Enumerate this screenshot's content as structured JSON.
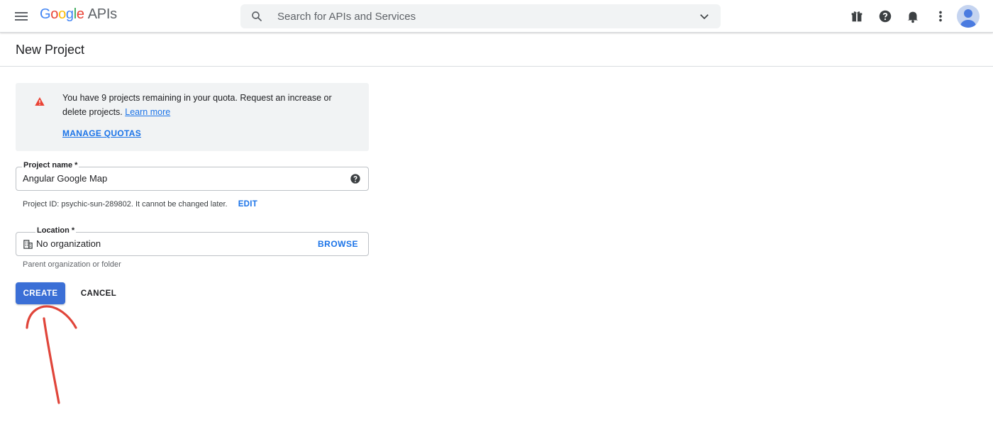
{
  "header": {
    "logo_letters": [
      "G",
      "o",
      "o",
      "g",
      "l",
      "e"
    ],
    "logo_suffix": "APIs",
    "search_placeholder": "Search for APIs and Services",
    "icons": [
      "menu-icon",
      "search-icon",
      "chevron-down-icon",
      "gift-icon",
      "help-icon",
      "notifications-bell-icon",
      "more-vert-icon",
      "avatar"
    ]
  },
  "page": {
    "title": "New Project"
  },
  "quota_notice": {
    "text": "You have 9 projects remaining in your quota. Request an increase or delete projects.",
    "learn_more": "Learn more",
    "manage_quotas": "MANAGE QUOTAS",
    "icon": "warning-icon",
    "icon_color": "#ea4335"
  },
  "form": {
    "project_name_label": "Project name *",
    "project_name_value": "Angular Google Map",
    "project_id_text": "Project ID: psychic-sun-289802. It cannot be changed later.",
    "edit_label": "EDIT",
    "location_label": "Location *",
    "location_value": "No organization",
    "browse_label": "BROWSE",
    "location_helper": "Parent organization or folder"
  },
  "actions": {
    "create_label": "CREATE",
    "cancel_label": "CANCEL"
  },
  "colors": {
    "primary": "#3b6fd6",
    "link": "#1a73e8",
    "annotation": "#e0453a"
  }
}
